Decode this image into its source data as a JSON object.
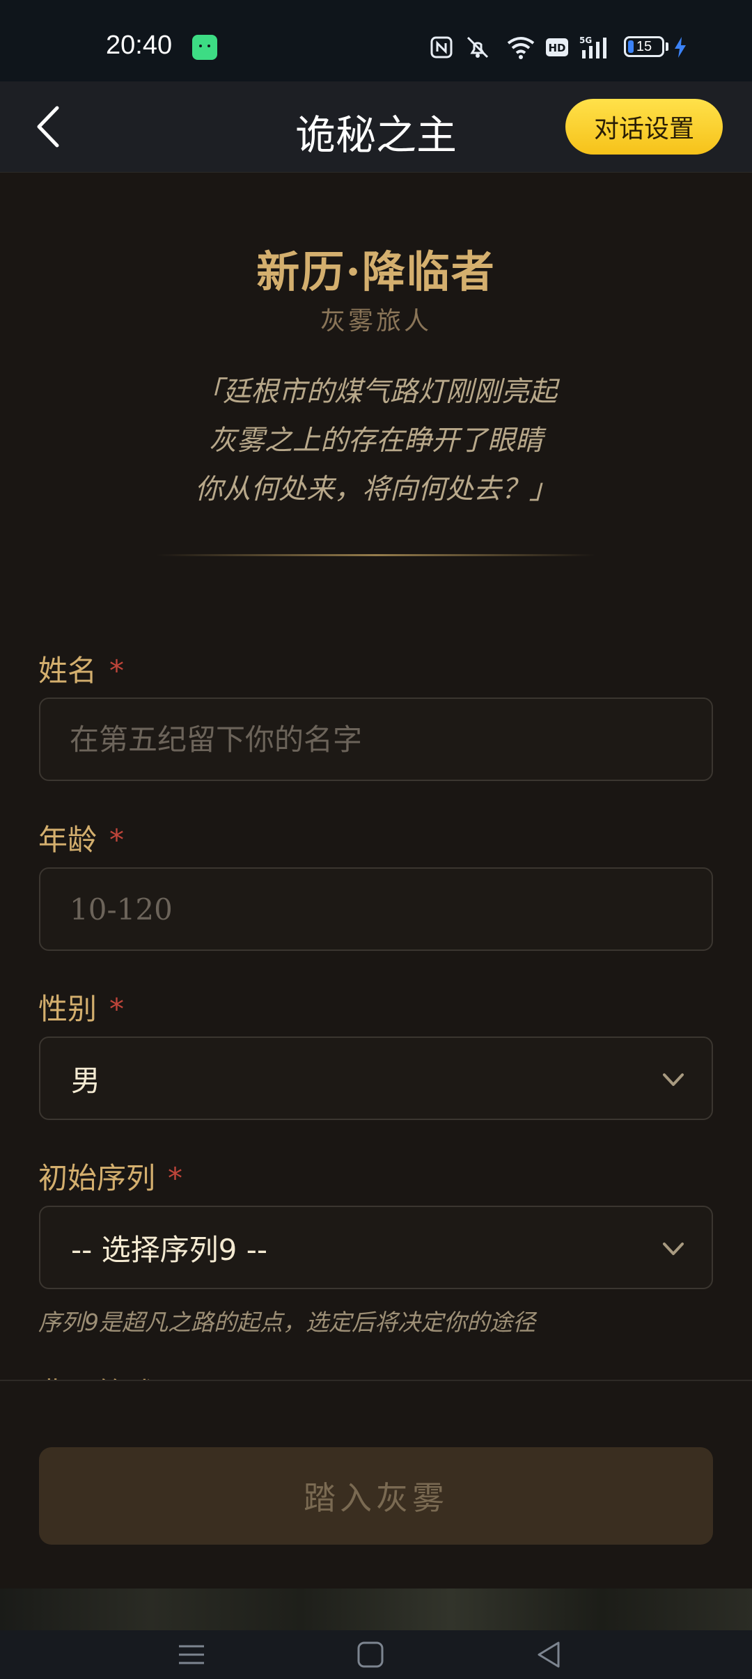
{
  "status_bar": {
    "time": "20:40",
    "icons": [
      "android-app-icon",
      "nfc-icon",
      "mute-icon",
      "wifi-icon",
      "hd-icon",
      "5g-signal-icon",
      "battery-icon",
      "charging-icon"
    ],
    "battery_level": "15"
  },
  "app_bar": {
    "title": "诡秘之主",
    "settings_label": "对话设置"
  },
  "hero": {
    "title": "新历·降临者",
    "subtitle": "灰雾旅人",
    "quote_lines": [
      "「廷根市的煤气路灯刚刚亮起",
      "灰雾之上的存在睁开了眼睛",
      "你从何处来，将向何处去？」"
    ]
  },
  "form": {
    "required_mark": "*",
    "name": {
      "label": "姓名",
      "placeholder": "在第五纪留下你的名字",
      "value": ""
    },
    "age": {
      "label": "年龄",
      "placeholder": "10-120",
      "value": ""
    },
    "gender": {
      "label": "性别",
      "value": "男"
    },
    "sequence": {
      "label": "初始序列",
      "value": "-- 选择序列9 --",
      "hint": "序列9是超凡之路的起点，选定后将决定你的途径"
    },
    "background": {
      "label": "背景简述"
    }
  },
  "submit": {
    "label": "踏入灰雾"
  },
  "colors": {
    "accent_gold": "#d4af6e",
    "settings_button": "#f6c21a",
    "required": "#c0453a",
    "background": "#1a1613"
  }
}
